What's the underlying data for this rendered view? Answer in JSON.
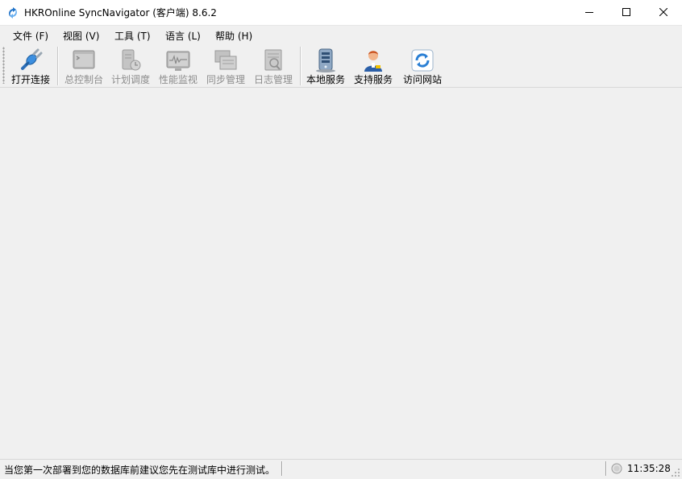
{
  "window": {
    "title": "HKROnline SyncNavigator (客户端) 8.6.2",
    "app_icon": "sync-logo-icon",
    "controls": [
      "minimize-icon",
      "maximize-icon",
      "close-icon"
    ]
  },
  "menu": [
    {
      "label": "文件 (F)"
    },
    {
      "label": "视图 (V)"
    },
    {
      "label": "工具 (T)"
    },
    {
      "label": "语言 (L)"
    },
    {
      "label": "帮助 (H)"
    }
  ],
  "toolbar": {
    "buttons": [
      {
        "label": "打开连接",
        "icon": "plug-connect-icon",
        "enabled": true
      },
      {
        "label": "总控制台",
        "icon": "console-icon",
        "enabled": false
      },
      {
        "label": "计划调度",
        "icon": "schedule-icon",
        "enabled": false
      },
      {
        "label": "性能监视",
        "icon": "performance-monitor-icon",
        "enabled": false
      },
      {
        "label": "同步管理",
        "icon": "sync-manage-icon",
        "enabled": false
      },
      {
        "label": "日志管理",
        "icon": "log-manage-icon",
        "enabled": false
      },
      {
        "label": "本地服务",
        "icon": "server-icon",
        "enabled": true
      },
      {
        "label": "支持服务",
        "icon": "support-person-icon",
        "enabled": true
      },
      {
        "label": "访问网站",
        "icon": "refresh-web-icon",
        "enabled": true
      }
    ]
  },
  "statusbar": {
    "message": "当您第一次部署到您的数据库前建议您先在测试库中进行测试。",
    "time": "11:35:28"
  },
  "colors": {
    "chrome_bg": "#f0f0f0",
    "titlebar_bg": "#ffffff",
    "disabled_text": "#8c8c8c",
    "accent_blue": "#2a7fd4"
  }
}
